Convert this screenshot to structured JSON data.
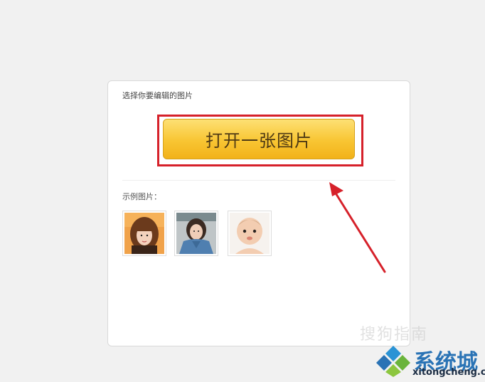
{
  "card": {
    "prompt": "选择你要编辑的图片",
    "open_button_label": "打开一张图片",
    "examples_label": "示例图片："
  },
  "examples": [
    {
      "name": "woman-brown-bangs"
    },
    {
      "name": "woman-denim-jacket"
    },
    {
      "name": "baby-face"
    }
  ],
  "watermark": {
    "sogou": "搜狗指南"
  },
  "brand": {
    "name": "系统城",
    "url": "xitongcheng.com",
    "logo_colors": [
      "#2a93d5",
      "#6ab43c",
      "#2a73b5",
      "#8cc63f"
    ]
  },
  "colors": {
    "button_top": "#fde074",
    "button_bottom": "#f2b21a",
    "highlight_border": "#d6212a",
    "arrow": "#d6212a"
  }
}
